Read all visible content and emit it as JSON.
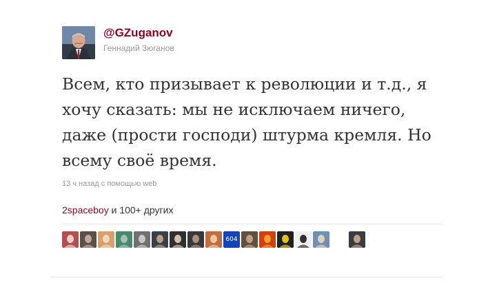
{
  "tweet": {
    "handle": "@GZuganov",
    "full_name": "Геннадий Зюганов",
    "text": "Всем, кто призывает к революции и т.д., я хочу сказать: мы не исключаем ничего, даже (прости господи) штурма кремля. Но всему своё время.",
    "timestamp": "13 ч назад",
    "via_prefix": " с помощью ",
    "via_source": "web"
  },
  "retweets": {
    "first_user": "2spaceboy",
    "others_label": " и 100+ других",
    "avatars": [
      {
        "icon": "avatar-thumb",
        "colors": [
          "#b05050",
          "#e8d0c8"
        ]
      },
      {
        "icon": "avatar-thumb",
        "colors": [
          "#5a5048",
          "#c0a898"
        ]
      },
      {
        "icon": "avatar-thumb",
        "colors": [
          "#d8a070",
          "#f0d8b8"
        ]
      },
      {
        "icon": "avatar-thumb",
        "colors": [
          "#4a8870",
          "#9ec4b0"
        ]
      },
      {
        "icon": "avatar-thumb",
        "colors": [
          "#707070",
          "#c8c8c8"
        ]
      },
      {
        "icon": "avatar-thumb",
        "colors": [
          "#3a4048",
          "#b89c84"
        ]
      },
      {
        "icon": "avatar-thumb",
        "colors": [
          "#303030",
          "#d0c0b0"
        ]
      },
      {
        "icon": "avatar-thumb",
        "colors": [
          "#383838",
          "#a89080"
        ]
      },
      {
        "icon": "avatar-thumb",
        "colors": [
          "#c07040",
          "#f0c8a0"
        ]
      },
      {
        "icon": "avatar-thumb",
        "colors": [
          "#1744b5",
          "#1744b5"
        ],
        "label": "604"
      },
      {
        "icon": "avatar-thumb",
        "colors": [
          "#605040",
          "#c0a080"
        ]
      },
      {
        "icon": "avatar-thumb",
        "colors": [
          "#d04010",
          "#f0a030"
        ]
      },
      {
        "icon": "avatar-thumb",
        "colors": [
          "#202020",
          "#e0c020"
        ]
      },
      {
        "icon": "avatar-thumb",
        "colors": [
          "#f0f0f0",
          "#303030"
        ]
      },
      {
        "icon": "avatar-thumb",
        "colors": [
          "#7090b0",
          "#e0d0c0"
        ]
      },
      {
        "icon": "avatar-thumb",
        "colors": [
          "#3a3c44",
          "#c0a088"
        ]
      }
    ]
  }
}
